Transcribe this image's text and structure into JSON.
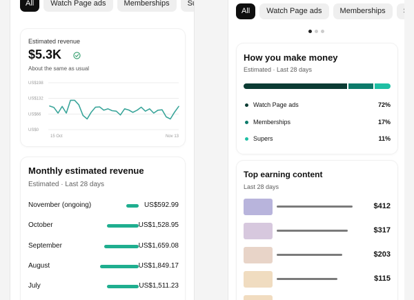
{
  "left_panel": {
    "chips": [
      "All",
      "Watch Page ads",
      "Memberships",
      "Su"
    ],
    "estimated_revenue": {
      "title": "Estimated revenue",
      "value": "$5.3K",
      "subtitle": "About the same as usual",
      "chart_data": {
        "type": "line",
        "x_labels": [
          "15 Oct",
          "Nov 13"
        ],
        "y_ticks": [
          "US$198",
          "US$132",
          "US$66",
          "US$0"
        ],
        "ylim": [
          0,
          198
        ],
        "grid": true,
        "series": [
          {
            "color": "#3aa59a",
            "values": [
              100,
              94,
              70,
              98,
              70,
              124,
              124,
              105,
              60,
              45,
              74,
              95,
              96,
              82,
              88,
              80,
              78,
              62,
              88,
              83,
              73,
              82,
              95,
              78,
              88,
              70,
              82,
              84,
              54,
              45,
              74,
              98
            ]
          }
        ]
      }
    },
    "monthly": {
      "title": "Monthly estimated revenue",
      "subtitle": "Estimated · Last 28 days",
      "rows": [
        {
          "label": "November (ongoing)",
          "value": "US$592.99",
          "amount": 592.99
        },
        {
          "label": "October",
          "value": "US$1,528.95",
          "amount": 1528.95
        },
        {
          "label": "September",
          "value": "US$1,659.08",
          "amount": 1659.08
        },
        {
          "label": "August",
          "value": "US$1,849.17",
          "amount": 1849.17
        },
        {
          "label": "July",
          "value": "US$1,511.23",
          "amount": 1511.23
        }
      ]
    }
  },
  "right_panel": {
    "chips": [
      "All",
      "Watch Page ads",
      "Memberships",
      "Su"
    ],
    "carousel": {
      "dots": 3,
      "active": 0
    },
    "how_you_make_money": {
      "title": "How you make money",
      "subtitle": "Estimated · Last 28 days",
      "sources": [
        {
          "label": "Watch Page ads",
          "percent": "72%",
          "share": 72,
          "color": "#0b3b33"
        },
        {
          "label": "Memberships",
          "percent": "17%",
          "share": 17,
          "color": "#0c7a6a"
        },
        {
          "label": "Supers",
          "percent": "11%",
          "share": 11,
          "color": "#1fbfa4"
        }
      ]
    },
    "top_earning": {
      "title": "Top earning content",
      "subtitle": "Last 28 days",
      "items": [
        {
          "value": "$412",
          "amount": 412,
          "thumb_color": "#b8b4dc"
        },
        {
          "value": "$317",
          "amount": 317,
          "thumb_color": "#d7c8de"
        },
        {
          "value": "$203",
          "amount": 203,
          "thumb_color": "#e8d4c8"
        },
        {
          "value": "$115",
          "amount": 115,
          "thumb_color": "#f0dcc0"
        },
        {
          "value": "",
          "amount": 0,
          "thumb_color": "#f1dcc0"
        }
      ]
    }
  }
}
